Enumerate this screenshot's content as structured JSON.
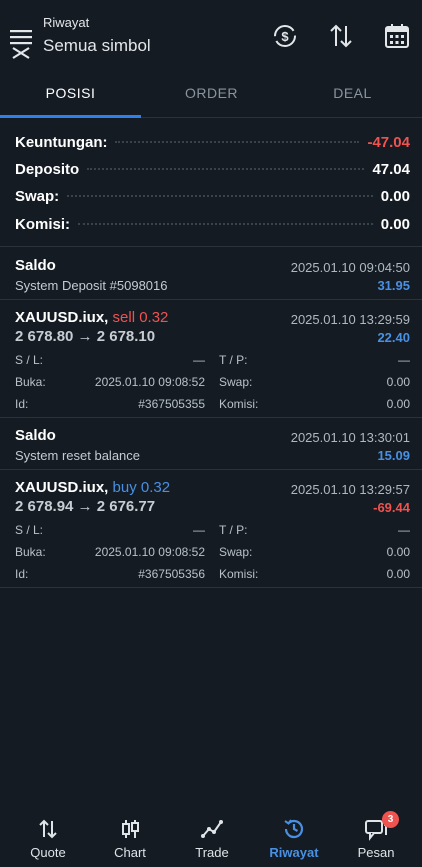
{
  "header": {
    "subtitle": "Riwayat",
    "title": "Semua simbol"
  },
  "tabs": [
    {
      "label": "POSISI"
    },
    {
      "label": "ORDER"
    },
    {
      "label": "DEAL"
    }
  ],
  "summary": {
    "profit_label": "Keuntungan:",
    "profit_value": "-47.04",
    "deposit_label": "Deposito",
    "deposit_value": "47.04",
    "swap_label": "Swap:",
    "swap_value": "0.00",
    "commission_label": "Komisi:",
    "commission_value": "0.00"
  },
  "entries": [
    {
      "title": "Saldo",
      "time": "2025.01.10 09:04:50",
      "desc": "System Deposit #5098016",
      "amount": "31.95"
    },
    {
      "symbol": "XAUUSD.iux,",
      "side": "sell 0.32",
      "time": "2025.01.10 13:29:59",
      "price": "2 678.80 → 2 678.10",
      "profit": "22.40",
      "sl_label": "S / L:",
      "sl_value": "—",
      "tp_label": "T / P:",
      "tp_value": "—",
      "open_label": "Buka:",
      "open_value": "2025.01.10 09:08:52",
      "swap_label": "Swap:",
      "swap_value": "0.00",
      "id_label": "Id:",
      "id_value": "#367505355",
      "commission_label": "Komisi:",
      "commission_value": "0.00"
    },
    {
      "title": "Saldo",
      "time": "2025.01.10 13:30:01",
      "desc": "System reset balance",
      "amount": "15.09"
    },
    {
      "symbol": "XAUUSD.iux,",
      "side": "buy 0.32",
      "time": "2025.01.10 13:29:57",
      "price": "2 678.94 → 2 676.77",
      "profit": "-69.44",
      "sl_label": "S / L:",
      "sl_value": "—",
      "tp_label": "T / P:",
      "tp_value": "—",
      "open_label": "Buka:",
      "open_value": "2025.01.10 09:08:52",
      "swap_label": "Swap:",
      "swap_value": "0.00",
      "id_label": "Id:",
      "id_value": "#367505356",
      "commission_label": "Komisi:",
      "commission_value": "0.00"
    }
  ],
  "nav": [
    {
      "label": "Quote",
      "icon": "quote-arrows-icon"
    },
    {
      "label": "Chart",
      "icon": "candlestick-icon"
    },
    {
      "label": "Trade",
      "icon": "trade-line-icon"
    },
    {
      "label": "Riwayat",
      "icon": "history-icon"
    },
    {
      "label": "Pesan",
      "icon": "message-icon",
      "badge": "3"
    }
  ],
  "colors": {
    "background": "#141b23",
    "accent": "#2f80ed",
    "positive": "#4a90e2",
    "negative": "#ef5350"
  }
}
